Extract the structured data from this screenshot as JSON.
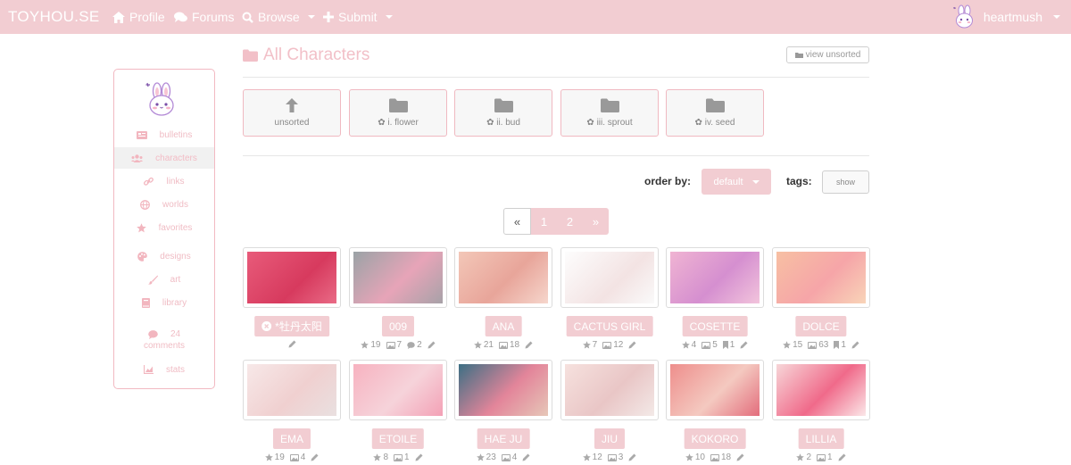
{
  "navbar": {
    "brand": "TOYHOU.SE",
    "profile": "Profile",
    "forums": "Forums",
    "browse": "Browse",
    "submit": "Submit",
    "username": "heartmush"
  },
  "sidebar": {
    "items": [
      {
        "label": "bulletins"
      },
      {
        "label": "characters"
      },
      {
        "label": "links"
      },
      {
        "label": "worlds"
      },
      {
        "label": "favorites"
      },
      {
        "label": "designs"
      },
      {
        "label": "art"
      },
      {
        "label": "library"
      },
      {
        "count": "24",
        "label": "comments"
      },
      {
        "label": "stats"
      }
    ]
  },
  "main": {
    "title": "All Characters",
    "view_unsorted": "view unsorted",
    "folders": [
      {
        "label": "unsorted"
      },
      {
        "label": "i. flower"
      },
      {
        "label": "ii. bud"
      },
      {
        "label": "iii. sprout"
      },
      {
        "label": "iv. seed"
      }
    ],
    "order_by_label": "order by:",
    "order_by_value": "default",
    "tags_label": "tags:",
    "tags_button": "show",
    "pagination": {
      "prev": "«",
      "pages": [
        "1",
        "2"
      ],
      "next": "»"
    }
  },
  "characters": [
    {
      "name": "*牡丹太阳",
      "stats": []
    },
    {
      "name": "009",
      "stats": [
        "19",
        "7",
        "2"
      ]
    },
    {
      "name": "ANA",
      "stats": [
        "21",
        "18"
      ]
    },
    {
      "name": "CACTUS GIRL",
      "stats": [
        "7",
        "12"
      ]
    },
    {
      "name": "COSETTE",
      "stats": [
        "4",
        "5",
        "1"
      ]
    },
    {
      "name": "DOLCE",
      "stats": [
        "15",
        "63",
        "1"
      ]
    },
    {
      "name": "EMA",
      "stats": [
        "19",
        "4"
      ]
    },
    {
      "name": "ETOILE",
      "stats": [
        "8",
        "1"
      ]
    },
    {
      "name": "HAE JU",
      "stats": [
        "23",
        "4"
      ]
    },
    {
      "name": "JIU",
      "stats": [
        "12",
        "3"
      ]
    },
    {
      "name": "KOKORO",
      "stats": [
        "10",
        "18"
      ]
    },
    {
      "name": "LILLIA",
      "stats": [
        "2",
        "1"
      ]
    }
  ],
  "colors": {
    "accent": "#f2cdd2",
    "accent_dark": "#e8a7b2"
  }
}
